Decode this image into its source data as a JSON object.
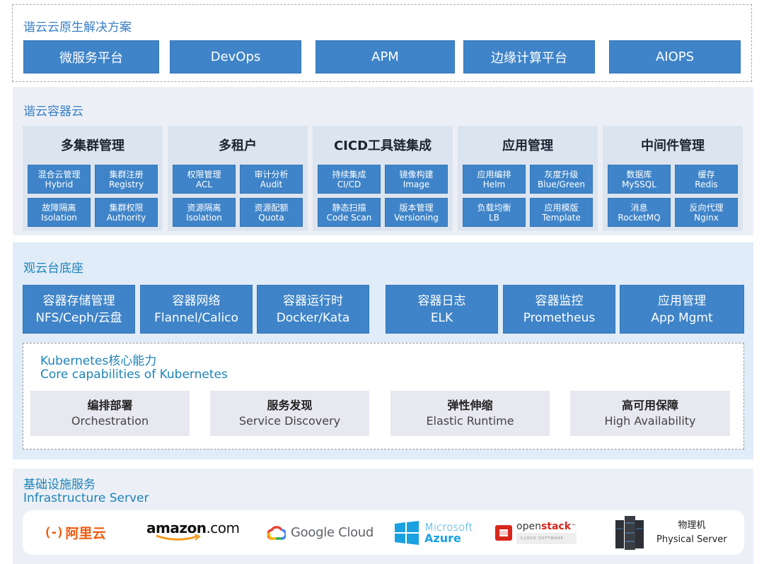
{
  "solutions": {
    "title": "谐云云原生解决方案",
    "items": [
      "微服务平台",
      "DevOps",
      "APM",
      "边缘计算平台",
      "AIOPS"
    ]
  },
  "container_cloud": {
    "title": "谐云容器云",
    "groups": [
      {
        "title": "多集群管理",
        "cells": [
          {
            "cn": "混合云管理",
            "en": "Hybrid"
          },
          {
            "cn": "集群注册",
            "en": "Registry"
          },
          {
            "cn": "故障隔离",
            "en": "Isolation"
          },
          {
            "cn": "集群权限",
            "en": "Authority"
          }
        ]
      },
      {
        "title": "多租户",
        "cells": [
          {
            "cn": "权限管理",
            "en": "ACL"
          },
          {
            "cn": "审计分析",
            "en": "Audit"
          },
          {
            "cn": "资源隔离",
            "en": "Isolation"
          },
          {
            "cn": "资源配额",
            "en": "Quota"
          }
        ]
      },
      {
        "title": "CICD工具链集成",
        "cells": [
          {
            "cn": "持续集成",
            "en": "CI/CD"
          },
          {
            "cn": "镜像构建",
            "en": "Image"
          },
          {
            "cn": "静态扫描",
            "en": "Code Scan"
          },
          {
            "cn": "版本管理",
            "en": "Versioning"
          }
        ]
      },
      {
        "title": "应用管理",
        "cells": [
          {
            "cn": "应用编排",
            "en": "Helm"
          },
          {
            "cn": "灰度升级",
            "en": "Blue/Green"
          },
          {
            "cn": "负载均衡",
            "en": "LB"
          },
          {
            "cn": "应用模版",
            "en": "Template"
          }
        ]
      },
      {
        "title": "中间件管理",
        "cells": [
          {
            "cn": "数据库",
            "en": "MySSQL"
          },
          {
            "cn": "缓存",
            "en": "Redis"
          },
          {
            "cn": "消息",
            "en": "RocketMQ"
          },
          {
            "cn": "反向代理",
            "en": "Nginx"
          }
        ]
      }
    ]
  },
  "base": {
    "title": "观云台底座",
    "boxes": [
      {
        "cn": "容器存储管理",
        "en": "NFS/Ceph/云盘"
      },
      {
        "cn": "容器网络",
        "en": "Flannel/Calico"
      },
      {
        "cn": "容器运行时",
        "en": "Docker/Kata"
      },
      {
        "cn": "容器日志",
        "en": "ELK"
      },
      {
        "cn": "容器监控",
        "en": "Prometheus"
      },
      {
        "cn": "应用管理",
        "en": "App Mgmt"
      }
    ],
    "k8s": {
      "title_cn": "Kubernetes核心能力",
      "title_en": "Core  capabilities  of Kubernetes",
      "capabilities": [
        {
          "cn": "编排部署",
          "en": "Orchestration"
        },
        {
          "cn": "服务发现",
          "en": "Service  Discovery"
        },
        {
          "cn": "弹性伸缩",
          "en": "Elastic  Runtime"
        },
        {
          "cn": "高可用保障",
          "en": "High  Availability"
        }
      ]
    }
  },
  "infra": {
    "title_cn": "基础设施服务",
    "title_en": "Infrastructure  Server",
    "logos": {
      "aliyun": {
        "bracket": "(-)",
        "text": "阿里云",
        "color": "#f05a0f"
      },
      "amazon": {
        "text_a": "amazon",
        "text_b": ".com",
        "smile_color": "#f29a1e"
      },
      "google": {
        "text": "Google Cloud"
      },
      "azure": {
        "line1": "Microsoft",
        "line2": "Azure",
        "color": "#1aa1e0"
      },
      "openstack": {
        "text_a": "open",
        "text_b": "stack",
        "tm": "™",
        "sub": "CLOUD SOFTWARE",
        "color": "#d9261c"
      },
      "physical": {
        "cn": "物理机",
        "en": "Physical  Server"
      }
    }
  },
  "colors": {
    "box_blue": "#3f84c8",
    "title_blue": "#3a7fc4",
    "teal": "#1d83b8",
    "panel_gray": "#ecf0f6",
    "panel_blue": "#e0ecf8"
  }
}
